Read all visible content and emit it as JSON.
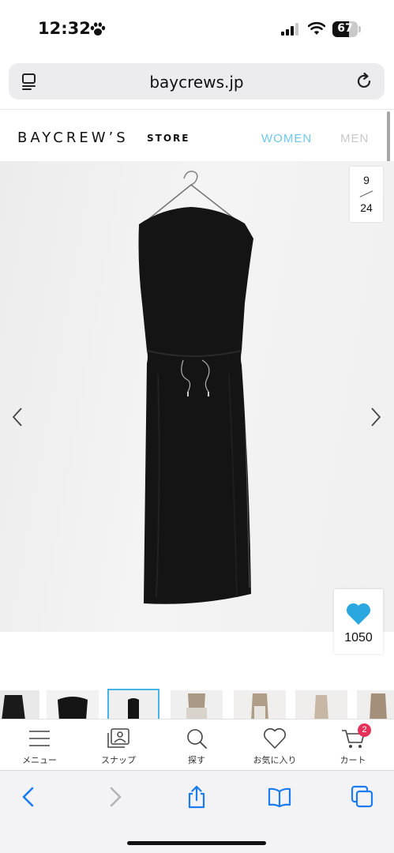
{
  "status_bar": {
    "time": "12:32",
    "battery": "67",
    "battery_level": 0.67
  },
  "browser": {
    "url": "baycrews.jp"
  },
  "site": {
    "logo": "BAYCREW’S",
    "logo_suffix": "STORE",
    "nav": {
      "women": "WOMEN",
      "men": "MEN"
    },
    "accent_color": "#6ec8ec"
  },
  "gallery": {
    "current": "9",
    "total": "24"
  },
  "favorite": {
    "count": "1050",
    "color": "#29a8e0"
  },
  "thumbnails": [
    "thumb-1",
    "thumb-2",
    "thumb-3",
    "thumb-4",
    "thumb-5",
    "thumb-6",
    "thumb-7"
  ],
  "app_nav": {
    "menu": "メニュー",
    "snap": "スナップ",
    "search": "探す",
    "favorites": "お気に入り",
    "cart": "カート",
    "cart_count": "2"
  }
}
